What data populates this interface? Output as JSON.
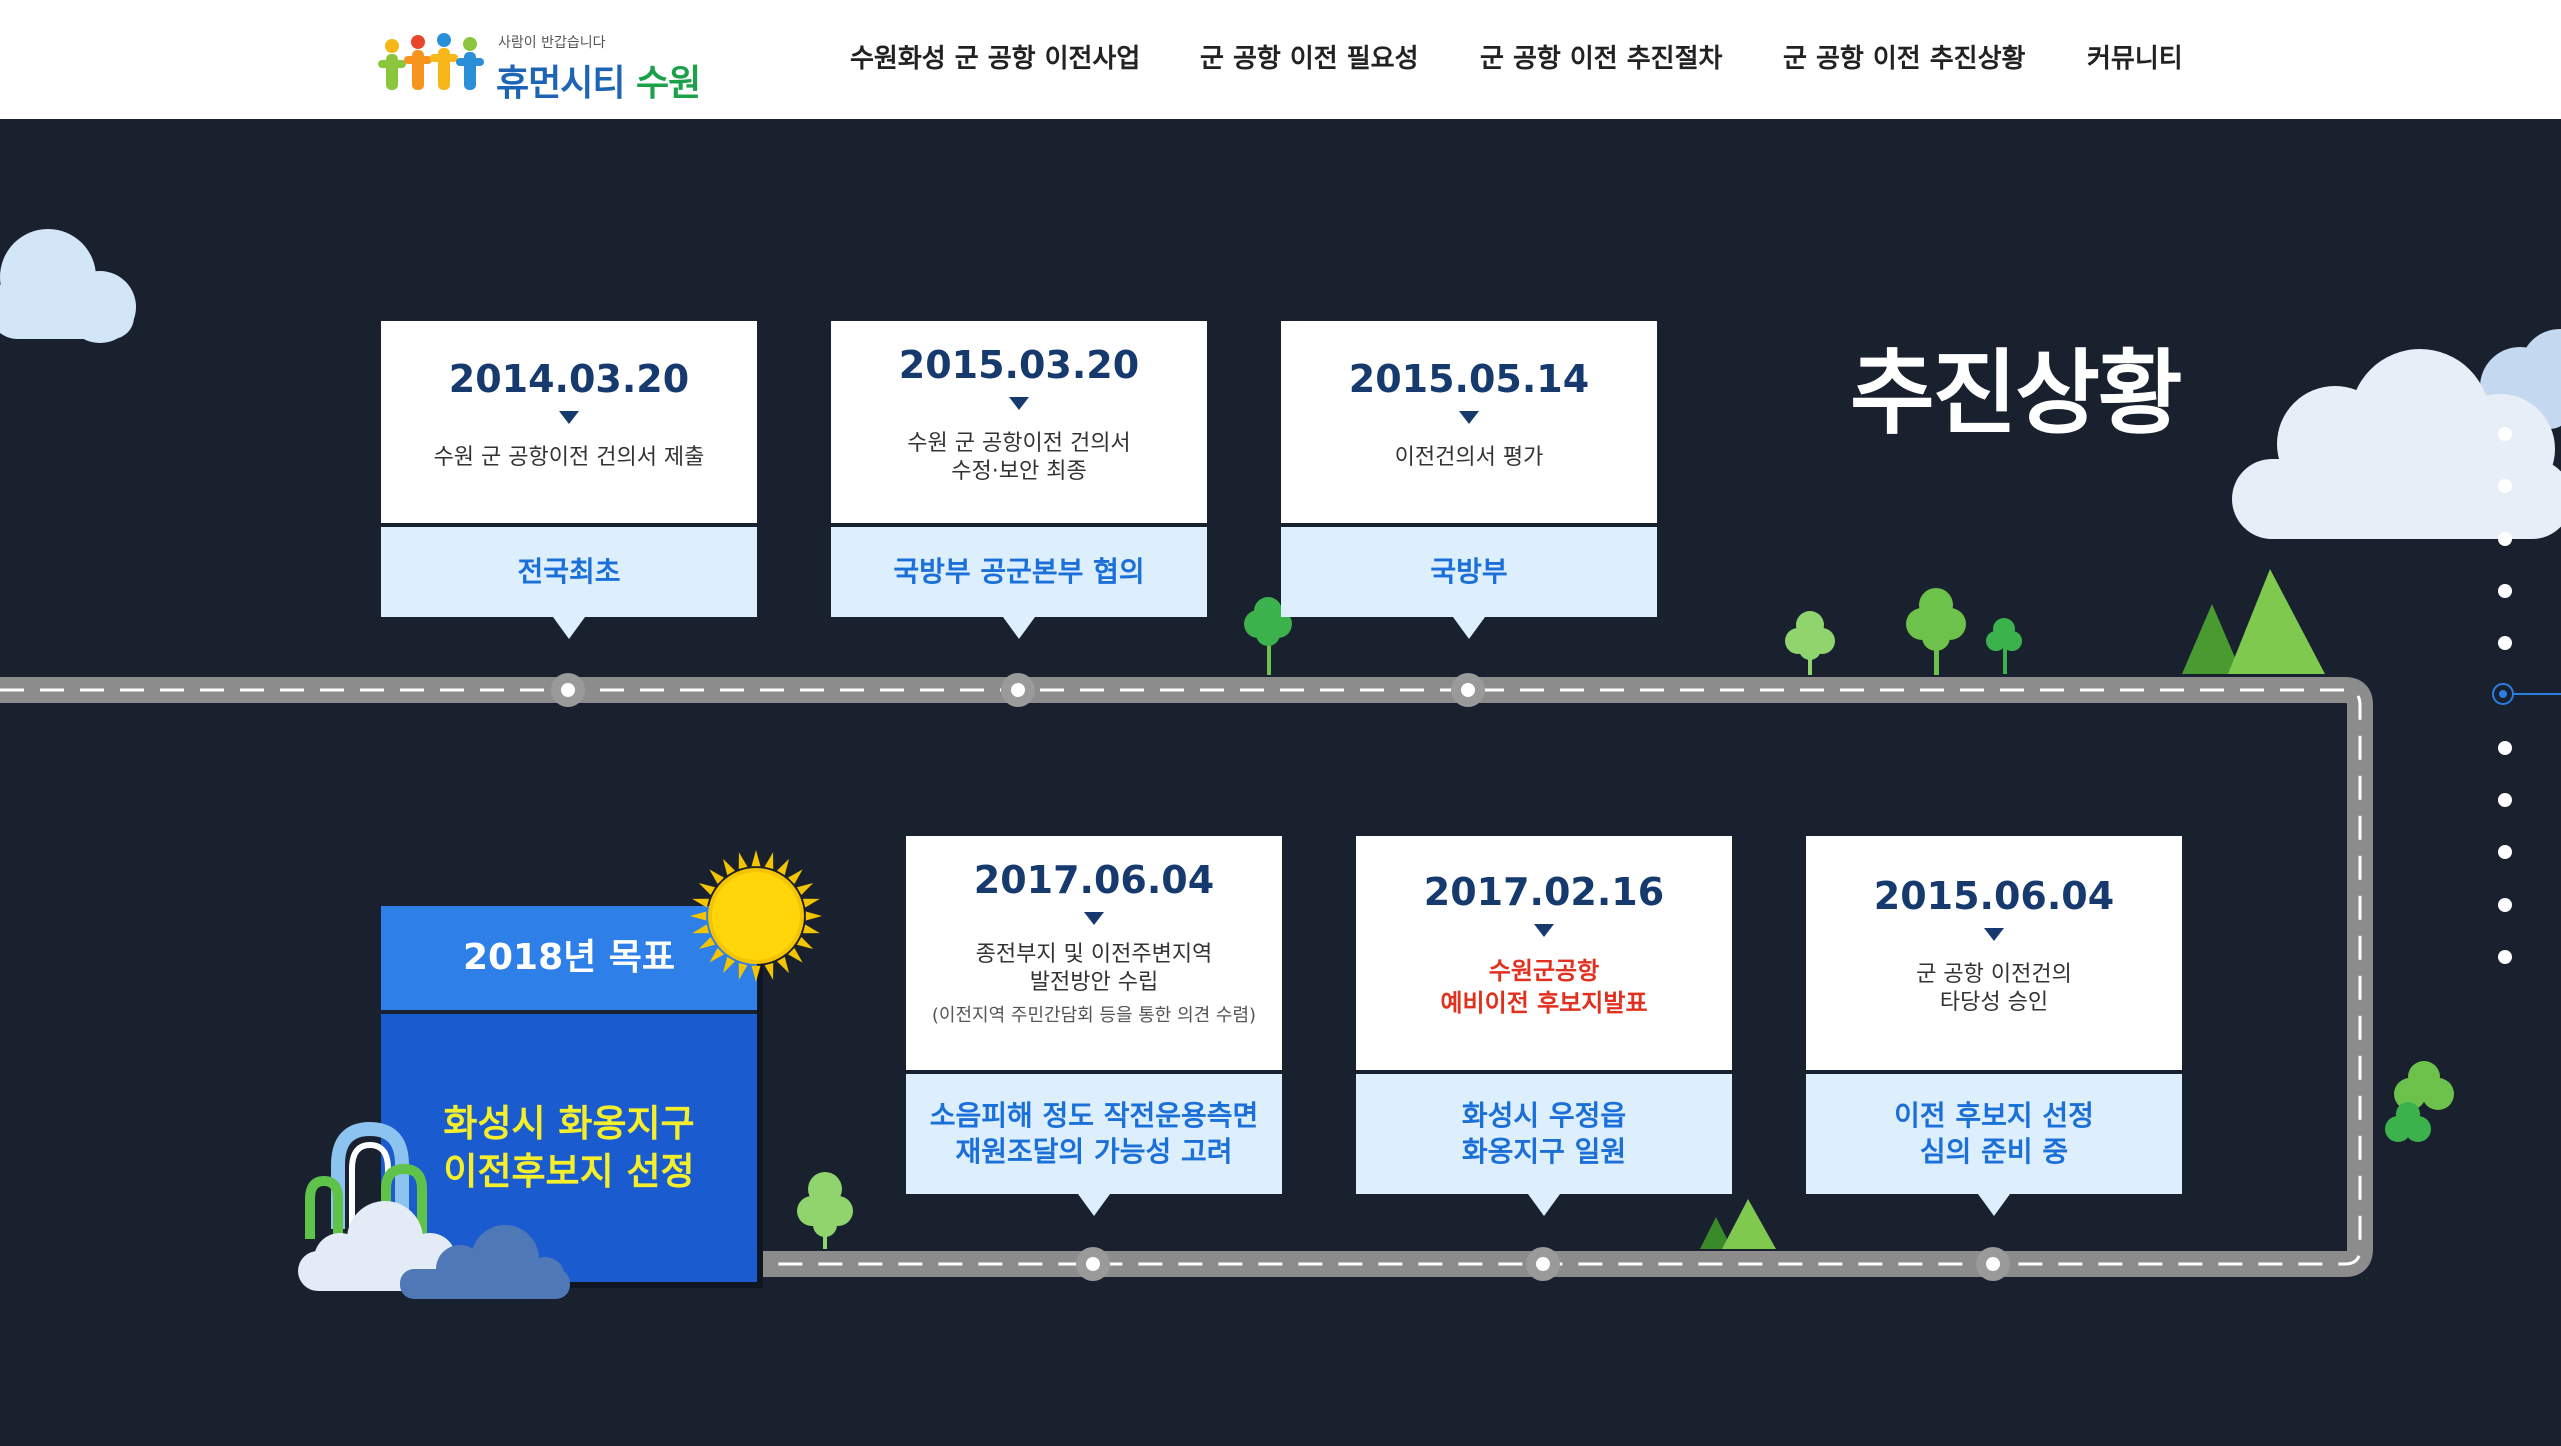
{
  "header": {
    "logo": {
      "tagline": "사람이 반갑습니다",
      "name_main": "휴먼시티",
      "name_accent": "수원"
    },
    "nav": [
      {
        "label": "수원화성 군 공항 이전사업"
      },
      {
        "label": "군 공항 이전 필요성"
      },
      {
        "label": "군 공항 이전 추진절차"
      },
      {
        "label": "군 공항 이전 추진상황"
      },
      {
        "label": "커뮤니티"
      }
    ]
  },
  "main": {
    "title": "추진상황",
    "timeline_top": [
      {
        "date": "2014.03.20",
        "desc": "수원 군 공항이전 건의서 제출",
        "tag": "전국최초"
      },
      {
        "date": "2015.03.20",
        "desc": "수원 군 공항이전 건의서\n수정·보안 최종",
        "tag": "국방부 공군본부 협의"
      },
      {
        "date": "2015.05.14",
        "desc": "이전건의서 평가",
        "tag": "국방부"
      }
    ],
    "timeline_bottom": [
      {
        "date": "2017.06.04",
        "desc": "종전부지 및 이전주변지역\n발전방안 수립",
        "note": "(이전지역 주민간담회 등을 통한 의견 수렴)",
        "tag": "소음피해 정도 작전운용측면\n재원조달의 가능성 고려"
      },
      {
        "date": "2017.02.16",
        "desc": "수원군공항\n예비이전 후보지발표",
        "highlight": true,
        "tag": "화성시 우정읍\n화옹지구 일원"
      },
      {
        "date": "2015.06.04",
        "desc": "군 공항 이전건의\n타당성 승인",
        "tag": "이전 후보지 선정\n심의 준비 중"
      }
    ],
    "goal": {
      "title": "2018년 목표",
      "text": "화성시 화옹지구\n이전후보지 선정"
    }
  },
  "pagination": {
    "count": 12,
    "active_index": 6
  },
  "colors": {
    "background": "#19212f",
    "card_date": "#173a6e",
    "card_tag": "#1a6fd8",
    "tag_background": "#ddeefd",
    "highlight": "#e2301f",
    "goal_head": "#2f7fe8",
    "goal_body": "#1b5bd0",
    "goal_text": "#f4ef2a",
    "road": "#8c8c8c"
  },
  "icons": [
    "logo-people-icon",
    "sun-icon",
    "cloud-icon",
    "tree-icon",
    "mountain-icon",
    "arch-landmark-icon"
  ]
}
